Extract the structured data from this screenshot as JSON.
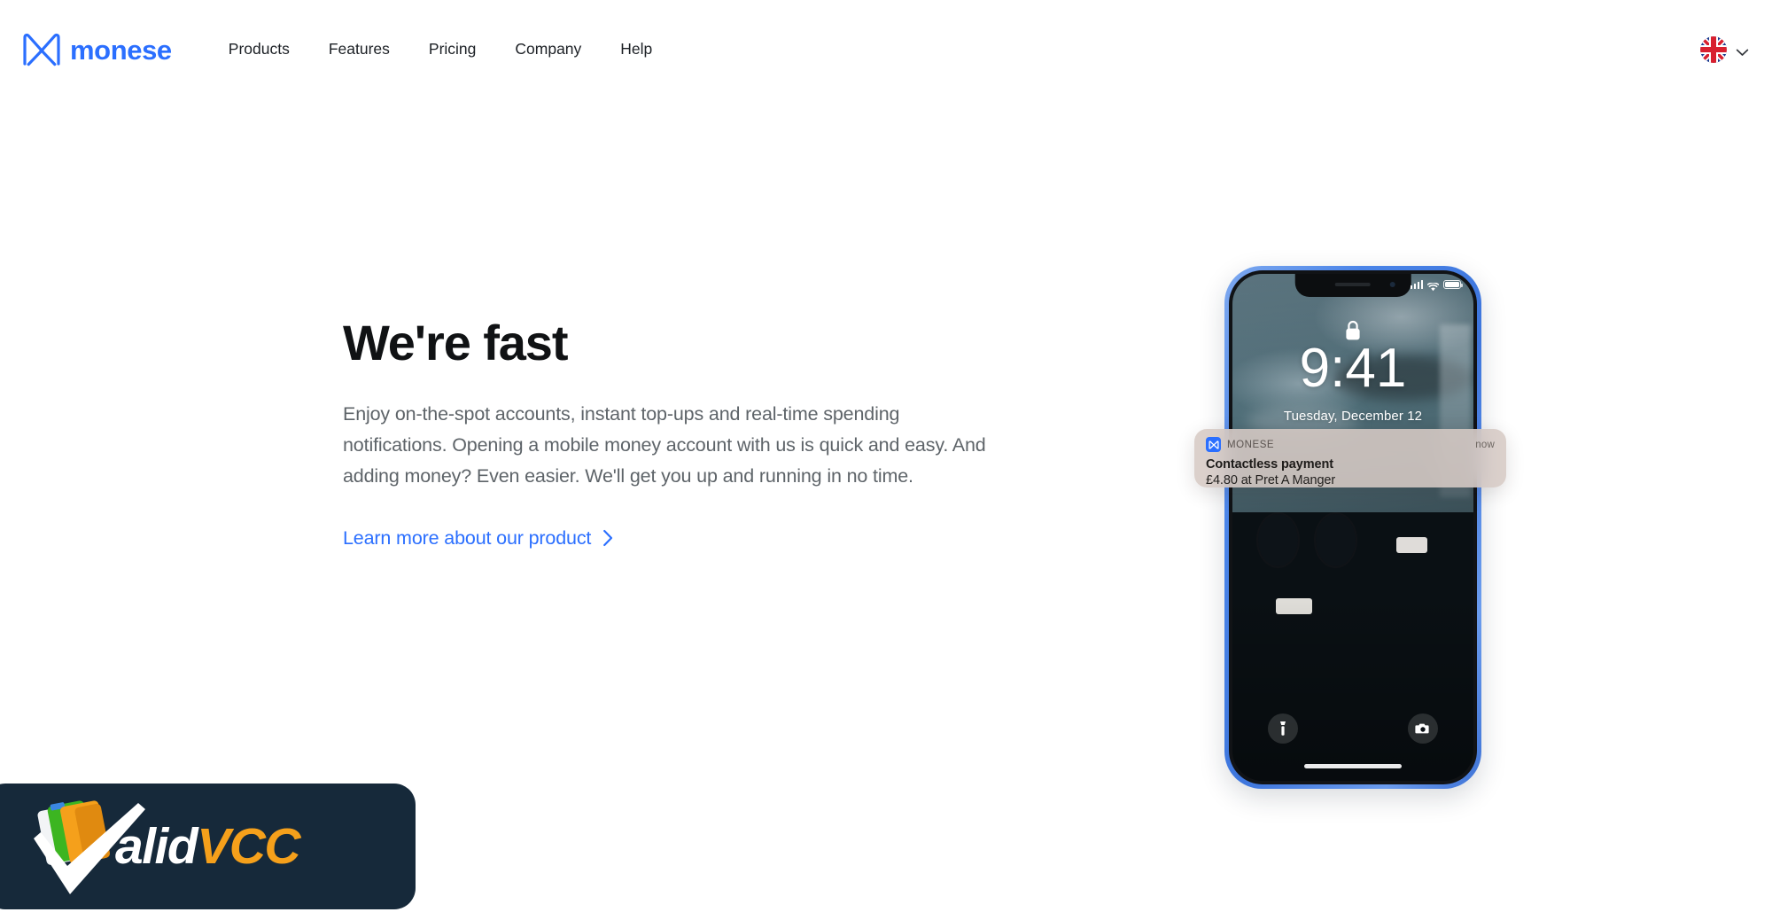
{
  "header": {
    "brand": {
      "name": "monese",
      "logo_icon": "monese-butterfly-mark",
      "color": "#2b6fff"
    },
    "nav": [
      {
        "label": "Products"
      },
      {
        "label": "Features"
      },
      {
        "label": "Pricing"
      },
      {
        "label": "Company"
      },
      {
        "label": "Help"
      }
    ],
    "locale": {
      "flag_icon": "uk-flag-icon",
      "chevron_icon": "chevron-down-icon"
    }
  },
  "hero": {
    "title": "We're fast",
    "paragraph": "Enjoy on-the-spot accounts, instant top-ups and real-time spending notifications. Opening a mobile money account with us is quick and easy. And adding money? Even easier. We'll get you up and running in no time.",
    "cta": {
      "label": "Learn more about our product",
      "icon": "chevron-right-icon",
      "color": "#2b6fff"
    }
  },
  "phone": {
    "frame_color": "#4a84e8",
    "lock_icon": "lock-icon",
    "time": "9:41",
    "date": "Tuesday, December 12",
    "status": {
      "signal_icon": "cellular-signal-icon",
      "wifi_icon": "wifi-icon",
      "battery_icon": "battery-icon"
    },
    "flashlight_icon": "flashlight-icon",
    "camera_icon": "camera-icon",
    "home_indicator": "home-indicator"
  },
  "notification": {
    "app_icon": "monese-app-icon",
    "app_name": "MONESE",
    "time": "now",
    "title": "Contactless payment",
    "body": "£4.80 at Pret A Manger"
  },
  "watermark": {
    "text_light": "alid",
    "text_accent": "VCC",
    "background": "#16293a",
    "accent_color": "#f5a01b",
    "check_icon": "validvcc-check-cards-icon"
  }
}
